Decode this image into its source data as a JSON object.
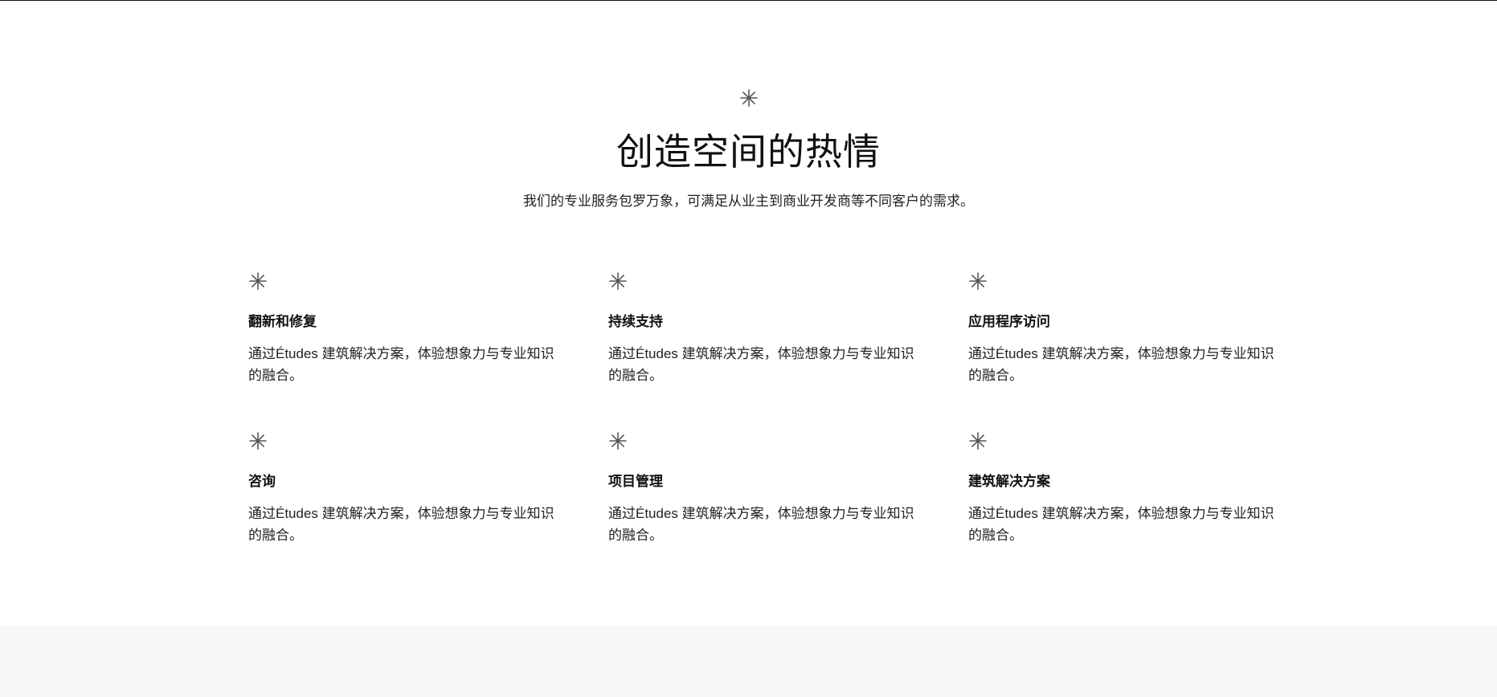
{
  "hero": {
    "icon": "asterisk-icon",
    "title": "创造空间的热情",
    "subtitle": "我们的专业服务包罗万象，可满足从业主到商业开发商等不同客户的需求。"
  },
  "features": [
    {
      "icon": "asterisk-icon",
      "title": "翻新和修复",
      "description": "通过Études 建筑解决方案，体验想象力与专业知识的融合。"
    },
    {
      "icon": "asterisk-icon",
      "title": "持续支持",
      "description": "通过Études 建筑解决方案，体验想象力与专业知识的融合。"
    },
    {
      "icon": "asterisk-icon",
      "title": "应用程序访问",
      "description": "通过Études 建筑解决方案，体验想象力与专业知识的融合。"
    },
    {
      "icon": "asterisk-icon",
      "title": "咨询",
      "description": "通过Études 建筑解决方案，体验想象力与专业知识的融合。"
    },
    {
      "icon": "asterisk-icon",
      "title": "项目管理",
      "description": "通过Études 建筑解决方案，体验想象力与专业知识的融合。"
    },
    {
      "icon": "asterisk-icon",
      "title": "建筑解决方案",
      "description": "通过Études 建筑解决方案，体验想象力与专业知识的融合。"
    }
  ],
  "colors": {
    "text": "#111111",
    "icon": "#555555",
    "footer_background": "#f7f7f7"
  }
}
